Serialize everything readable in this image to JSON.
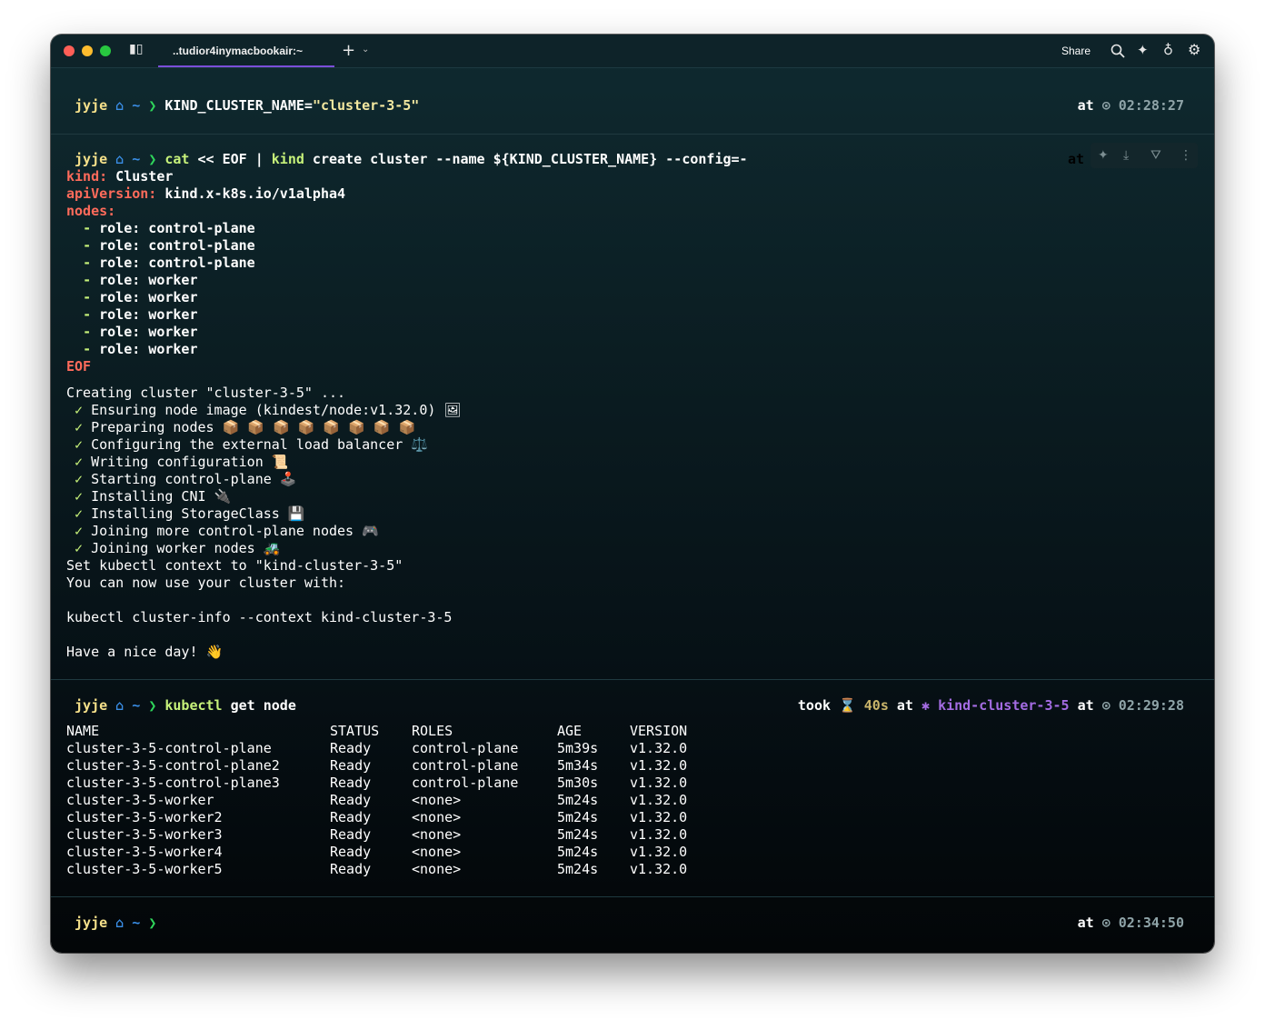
{
  "window": {
    "tab_title": "..tudior4inymacbookair:~",
    "share_label": "Share",
    "icons": [
      "sidebar-toggle-icon",
      "new-tab-icon",
      "chevron-down-icon",
      "search-icon",
      "sparkle-icon",
      "lightbulb-icon",
      "gear-icon"
    ]
  },
  "prompt": {
    "apple": "",
    "user": "jyje",
    "home": "⌂",
    "tilde": "~",
    "arrow": "❯",
    "at": "at",
    "clock": "⊙"
  },
  "blocks": [
    {
      "command_plain": "KIND_CLUSTER_NAME=",
      "command_str": "\"cluster-3-5\"",
      "time": "02:28:27"
    },
    {
      "cmd_cat": "cat",
      "cmd_heredoc": " << EOF | ",
      "cmd_kind": "kind",
      "cmd_rest": " create cluster --name ${KIND_CLUSTER_NAME} --config=-",
      "yaml": [
        {
          "key": "kind:",
          "val": " Cluster"
        },
        {
          "key": "apiVersion:",
          "val": " kind.x-k8s.io/v1alpha4"
        },
        {
          "key": "nodes:",
          "val": ""
        }
      ],
      "roles": [
        "role: control-plane",
        "role: control-plane",
        "role: control-plane",
        "role: worker",
        "role: worker",
        "role: worker",
        "role: worker",
        "role: worker"
      ],
      "eof": "EOF",
      "creating": "Creating cluster \"cluster-3-5\" ...",
      "steps": [
        " Ensuring node image (kindest/node:v1.32.0) 🖼",
        " Preparing nodes 📦 📦 📦 📦 📦 📦 📦 📦",
        " Configuring the external load balancer ⚖️",
        " Writing configuration 📜",
        " Starting control-plane 🕹️",
        " Installing CNI 🔌",
        " Installing StorageClass 💾",
        " Joining more control-plane nodes 🎮",
        " Joining worker nodes 🚜"
      ],
      "check": "✓",
      "set_context": "Set kubectl context to \"kind-cluster-3-5\"",
      "you_can": "You can now use your cluster with:",
      "cluster_info": "kubectl cluster-info --context kind-cluster-3-5",
      "nice_day": "Have a nice day! 👋"
    },
    {
      "cmd_kubectl": "kubectl",
      "cmd_rest": " get node",
      "took": "took",
      "hourglass": "⌛",
      "duration": "40s",
      "star": "✱",
      "context": "kind-cluster-3-5",
      "time": "02:29:28",
      "table": {
        "headers": [
          "NAME",
          "STATUS",
          "ROLES",
          "AGE",
          "VERSION"
        ],
        "rows": [
          [
            "cluster-3-5-control-plane",
            "Ready",
            "control-plane",
            "5m39s",
            "v1.32.0"
          ],
          [
            "cluster-3-5-control-plane2",
            "Ready",
            "control-plane",
            "5m34s",
            "v1.32.0"
          ],
          [
            "cluster-3-5-control-plane3",
            "Ready",
            "control-plane",
            "5m30s",
            "v1.32.0"
          ],
          [
            "cluster-3-5-worker",
            "Ready",
            "<none>",
            "5m24s",
            "v1.32.0"
          ],
          [
            "cluster-3-5-worker2",
            "Ready",
            "<none>",
            "5m24s",
            "v1.32.0"
          ],
          [
            "cluster-3-5-worker3",
            "Ready",
            "<none>",
            "5m24s",
            "v1.32.0"
          ],
          [
            "cluster-3-5-worker4",
            "Ready",
            "<none>",
            "5m24s",
            "v1.32.0"
          ],
          [
            "cluster-3-5-worker5",
            "Ready",
            "<none>",
            "5m24s",
            "v1.32.0"
          ]
        ]
      }
    },
    {
      "time": "02:34:50"
    }
  ],
  "colors": {
    "user": "#f5e08a",
    "command": "#c7f27a",
    "yaml_key": "#ff6b5b",
    "context": "#a46ce3",
    "accent_tab": "#7b4ed9"
  }
}
